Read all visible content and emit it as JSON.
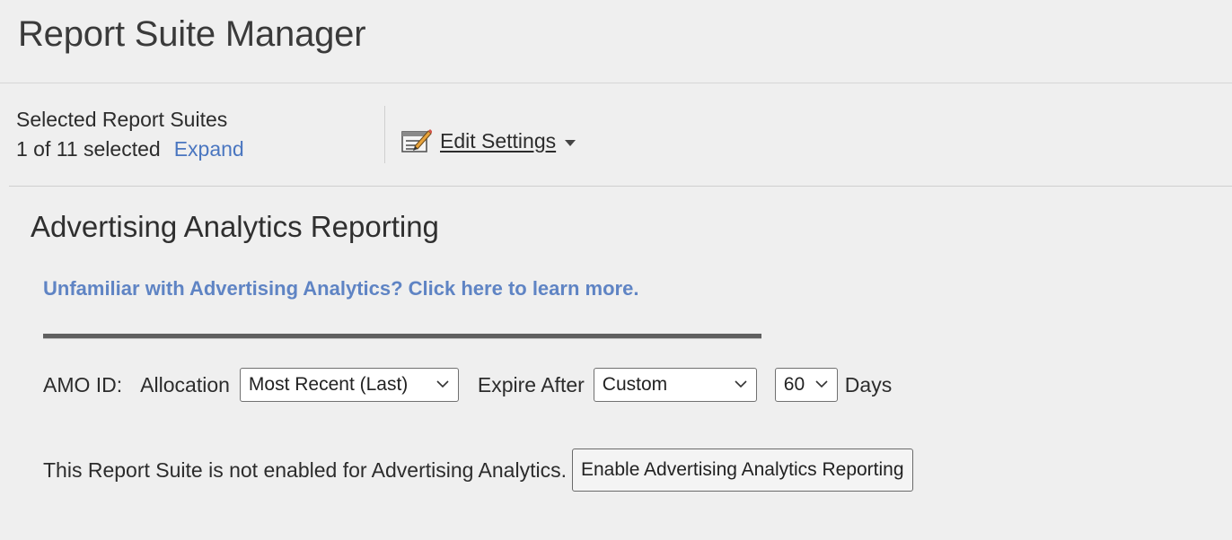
{
  "app": {
    "title": "Report Suite Manager"
  },
  "selection": {
    "title": "Selected Report Suites",
    "count_text": "1 of 11 selected",
    "expand_label": "Expand"
  },
  "toolbar": {
    "edit_settings_label": "Edit Settings",
    "edit_icon": "edit-settings-icon"
  },
  "section": {
    "heading": "Advertising Analytics Reporting",
    "learn_more_link": "Unfamiliar with Advertising Analytics? Click here to learn more."
  },
  "settings": {
    "amo_id_label": "AMO ID:",
    "allocation_label": "Allocation",
    "allocation_value": "Most Recent (Last)",
    "expire_label": "Expire After",
    "expire_value": "Custom",
    "days_value": "60",
    "days_label": "Days"
  },
  "status": {
    "message": "This Report Suite is not enabled for Advertising Analytics.",
    "enable_button_label": "Enable Advertising Analytics Reporting"
  },
  "colors": {
    "background": "#efefef",
    "link": "#4a76c0",
    "link_bold": "#5f84c4",
    "rule": "#5f5f5f"
  }
}
